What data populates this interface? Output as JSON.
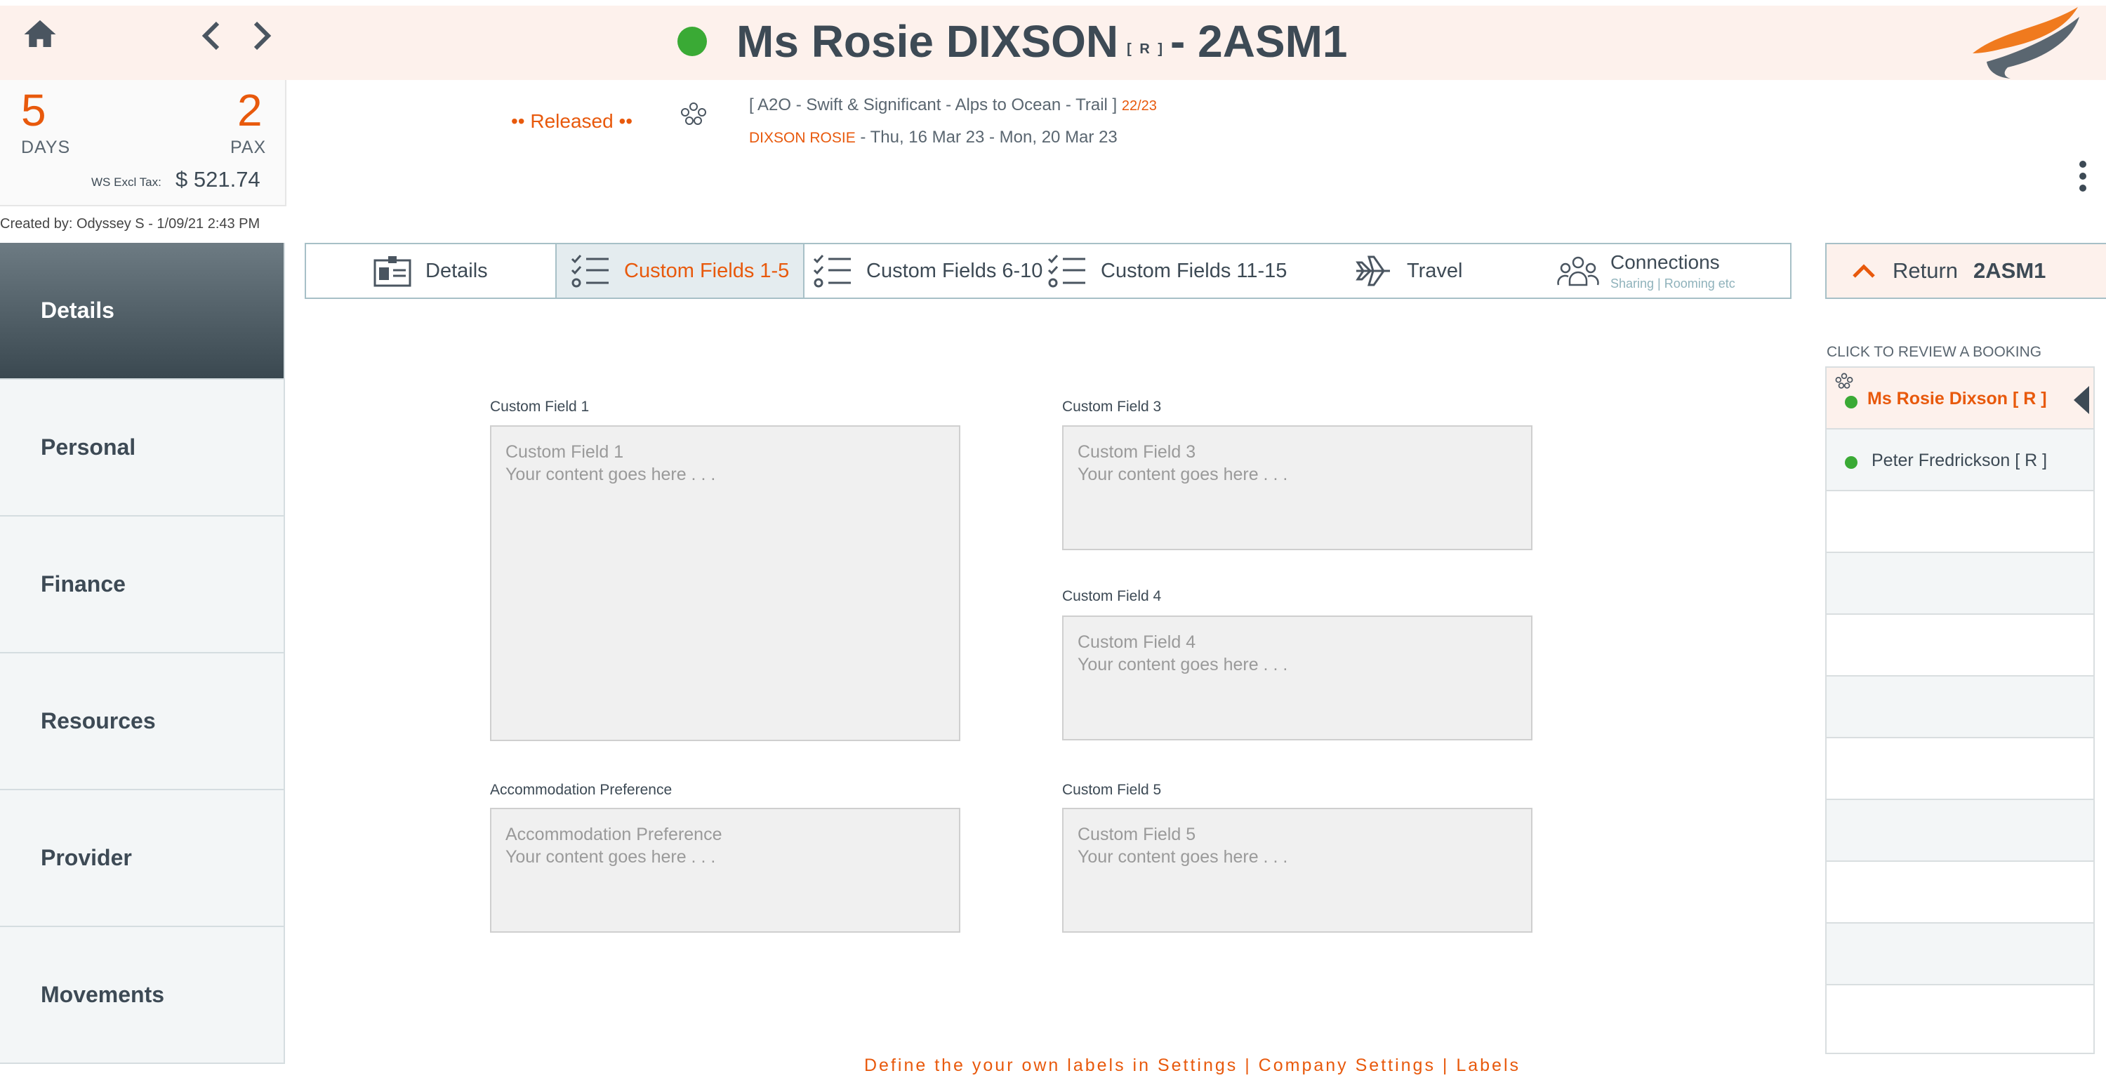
{
  "header": {
    "name": "Ms Rosie DIXSON",
    "role_tag": "[ R ]",
    "code": "- 2ASM1",
    "status_color": "#3aaa35"
  },
  "summary": {
    "days_value": "5",
    "days_label": "DAYS",
    "pax_value": "2",
    "pax_label": "PAX",
    "tax_label": "WS Excl Tax:",
    "tax_amount": "$ 521.74"
  },
  "created_by": "Created by: Odyssey S - 1/09/21 2:43 PM",
  "booking": {
    "status": "•• Released ••",
    "tour": "[ A2O - Swift & Significant - Alps to Ocean - Trail ]",
    "tour_code": "22/23",
    "pax_name": "DIXSON ROSIE",
    "dates": "- Thu, 16 Mar 23 - Mon, 20 Mar 23"
  },
  "sidebar": {
    "items": [
      {
        "label": "Details"
      },
      {
        "label": "Personal"
      },
      {
        "label": "Finance"
      },
      {
        "label": "Resources"
      },
      {
        "label": "Provider"
      },
      {
        "label": "Movements"
      }
    ]
  },
  "tabs": {
    "details": "Details",
    "cf1": "Custom Fields 1-5",
    "cf2": "Custom Fields  6-10",
    "cf3": "Custom Fields  11-15",
    "travel": "Travel",
    "connections": "Connections",
    "connections_sub": "Sharing | Rooming etc"
  },
  "return_button": {
    "label": "Return",
    "code": "2ASM1"
  },
  "form": {
    "cf1_label": "Custom Field 1",
    "cf1_title": "Custom Field 1",
    "cf1_text": "Your content goes here . . .",
    "cf3_label": "Custom Field 3",
    "cf3_title": "Custom Field 3",
    "cf3_text": "Your content goes here . . .",
    "cf4_label": "Custom Field 4",
    "cf4_title": "Custom Field 4",
    "cf4_text": "Your content goes here . . .",
    "acc_label": "Accommodation Preference",
    "acc_title": "Accommodation Preference",
    "acc_text": "Your content goes here . . .",
    "cf5_label": "Custom Field 5",
    "cf5_title": "Custom Field 5",
    "cf5_text": "Your content goes here . . .",
    "footer_note": "Define the your own labels in Settings | Company Settings | Labels"
  },
  "review": {
    "heading": "CLICK TO REVIEW A BOOKING",
    "bookings": [
      {
        "name": "Ms Rosie Dixson  [ R ]",
        "status_color": "#3aaa35"
      },
      {
        "name": "Peter Fredrickson  [ R ]",
        "status_color": "#3aaa35"
      }
    ]
  },
  "colors": {
    "accent": "#e8590c",
    "text": "#3d4a55",
    "header_bg": "#fdf1ec"
  }
}
